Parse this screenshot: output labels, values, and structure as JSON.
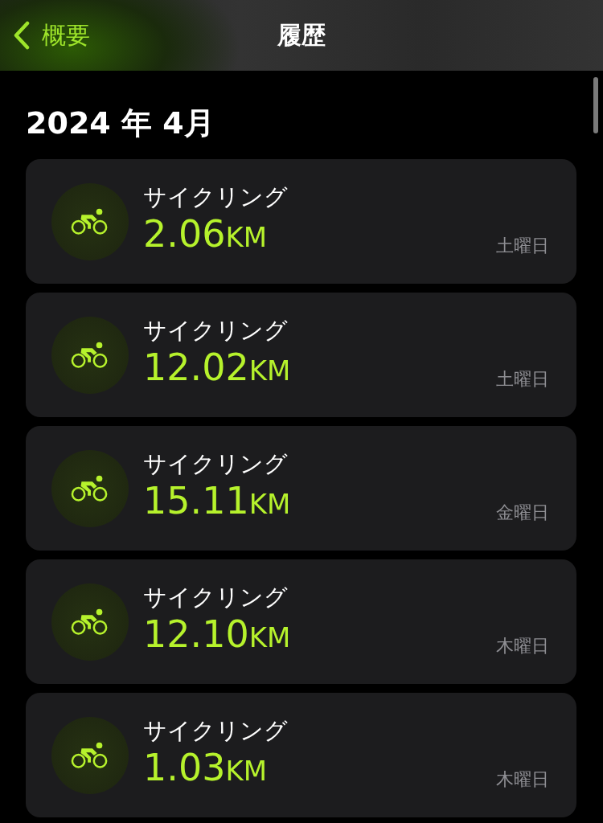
{
  "nav": {
    "back_label": "概要",
    "title": "履歴"
  },
  "section": {
    "title": "2024 年 4月"
  },
  "workouts": [
    {
      "name": "サイクリング",
      "distance": "2.06",
      "unit": "KM",
      "day": "土曜日"
    },
    {
      "name": "サイクリング",
      "distance": "12.02",
      "unit": "KM",
      "day": "土曜日"
    },
    {
      "name": "サイクリング",
      "distance": "15.11",
      "unit": "KM",
      "day": "金曜日"
    },
    {
      "name": "サイクリング",
      "distance": "12.10",
      "unit": "KM",
      "day": "木曜日"
    },
    {
      "name": "サイクリング",
      "distance": "1.03",
      "unit": "KM",
      "day": "木曜日"
    }
  ]
}
